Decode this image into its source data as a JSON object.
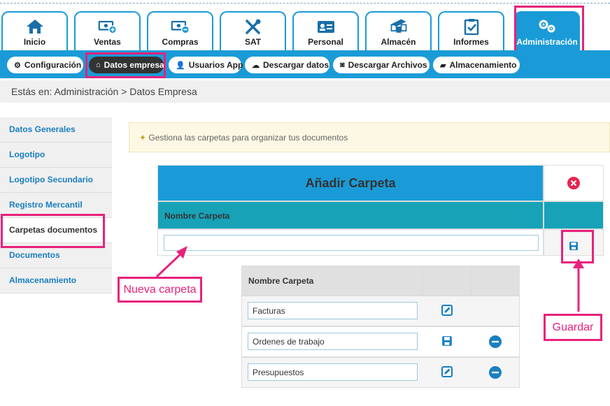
{
  "tabs": [
    {
      "label": "Inicio",
      "icon": "home-icon"
    },
    {
      "label": "Ventas",
      "icon": "money-add-icon"
    },
    {
      "label": "Compras",
      "icon": "money-remove-icon"
    },
    {
      "label": "SAT",
      "icon": "tools-icon"
    },
    {
      "label": "Personal",
      "icon": "id-card-icon"
    },
    {
      "label": "Almacén",
      "icon": "boxes-icon"
    },
    {
      "label": "Informes",
      "icon": "clipboard-icon"
    },
    {
      "label": "Administración",
      "icon": "gears-icon"
    }
  ],
  "subnav": [
    {
      "label": "Configuración",
      "icon": "gear-icon"
    },
    {
      "label": "Datos empresa",
      "icon": "home-icon"
    },
    {
      "label": "Usuarios App",
      "icon": "user-icon"
    },
    {
      "label": "Descargar datos",
      "icon": "cloud-download-icon"
    },
    {
      "label": "Descargar Archivos",
      "icon": "camera-icon"
    },
    {
      "label": "Almacenamiento",
      "icon": "folder-icon"
    }
  ],
  "breadcrumb": "Estás en: Administración > Datos Empresa",
  "sidebar": [
    {
      "label": "Datos Generales"
    },
    {
      "label": "Logotipo"
    },
    {
      "label": "Logotipo Secundario"
    },
    {
      "label": "Registro Mercantil"
    },
    {
      "label": "Carpetas documentos"
    },
    {
      "label": "Documentos"
    },
    {
      "label": "Almacenamiento"
    }
  ],
  "alert": "Gestiona las carpetas para organizar tus documentos",
  "add_folder": {
    "title": "Añadir Carpeta",
    "column": "Nombre Carpeta",
    "input_value": ""
  },
  "folders": {
    "column": "Nombre Carpeta",
    "rows": [
      {
        "name": "Facturas",
        "action": "edit-icon",
        "delete": false
      },
      {
        "name": "Ordenes de trabajo",
        "action": "save-icon",
        "delete": true
      },
      {
        "name": "Presupuestos",
        "action": "edit-icon",
        "delete": true
      }
    ]
  },
  "annotations": {
    "new_folder": "Nueva carpeta",
    "save": "Guardar"
  },
  "colors": {
    "primary": "#1a9bd7",
    "teal": "#17a2b8",
    "highlight": "#e8227c",
    "danger": "#e8234e",
    "alert_bg": "#fcf8e3"
  }
}
